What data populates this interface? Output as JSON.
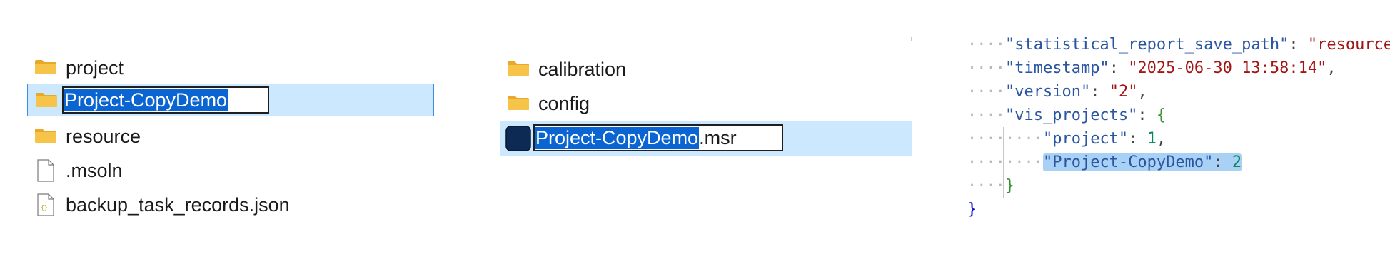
{
  "explorer_left": {
    "items": [
      {
        "name": "project",
        "icon": "folder-icon"
      },
      {
        "name": "Project-CopyDemo",
        "icon": "folder-icon",
        "selected": true,
        "renaming": true
      },
      {
        "name": "resource",
        "icon": "folder-icon"
      },
      {
        "name": ".msoln",
        "icon": "file-icon"
      },
      {
        "name": "backup_task_records.json",
        "icon": "json-file-icon"
      }
    ]
  },
  "explorer_right": {
    "items": [
      {
        "name": "calibration",
        "icon": "folder-icon"
      },
      {
        "name": "config",
        "icon": "folder-icon"
      },
      {
        "name_selected": "Project-CopyDemo",
        "extension": ".msr",
        "icon": "app-file-icon",
        "selected": true,
        "renaming": true
      }
    ]
  },
  "json_editor": {
    "lines": [
      {
        "key": "\"statistical_report_save_path\"",
        "sep": ": ",
        "value": "\"resource\"",
        "tail": ","
      },
      {
        "key": "\"timestamp\"",
        "sep": ": ",
        "value": "\"2025-06-30 13:58:14\"",
        "tail": ","
      },
      {
        "key": "\"version\"",
        "sep": ": ",
        "value": "\"2\"",
        "tail": ","
      },
      {
        "key": "\"vis_projects\"",
        "sep": ": ",
        "value": "{",
        "tail": ""
      },
      {
        "key": "\"project\"",
        "sep": ": ",
        "value": "1",
        "tail": ","
      },
      {
        "key": "\"Project-CopyDemo\"",
        "sep": ": ",
        "value": "2",
        "tail": ""
      },
      {
        "close": "}"
      },
      {
        "close": "}"
      }
    ]
  },
  "colors": {
    "selection": "#cce8ff",
    "selection_border": "#3c8fde",
    "text_highlight": "#0a64d1",
    "folder": "#f7c44a"
  }
}
